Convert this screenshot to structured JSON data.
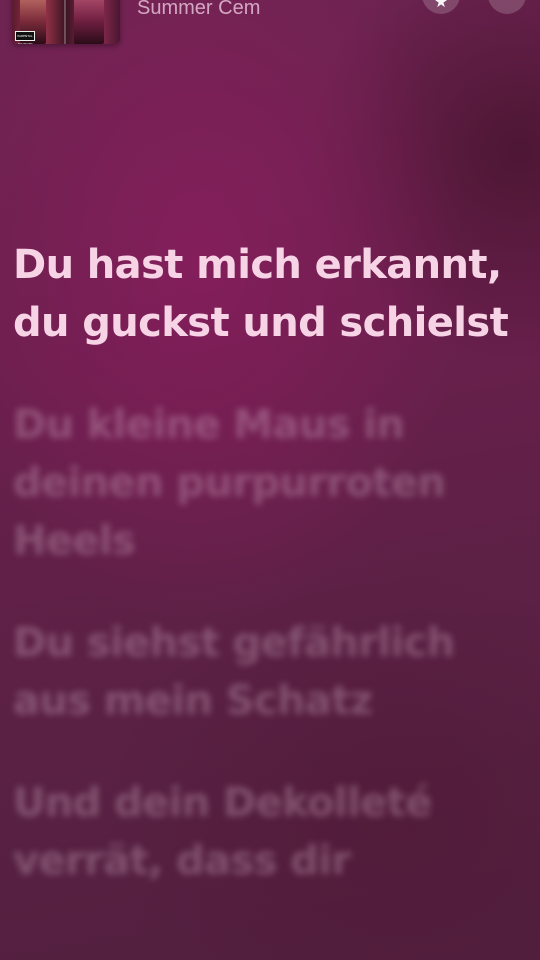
{
  "now_playing": {
    "artist": "Summer Cem",
    "artwork_badge": "PARENTAL ADVISORY"
  },
  "header_buttons": {
    "favorite_icon": "star-icon",
    "more_icon": "more-icon"
  },
  "lyrics": [
    {
      "text": "Du hast mich erkannt, du guckst und schielst",
      "state": "active"
    },
    {
      "text": "Du kleine Maus in deinen purpurroten Heels",
      "state": "upcoming"
    },
    {
      "text": "Du siehst gefährlich aus mein Schatz",
      "state": "upcoming"
    },
    {
      "text": "Und dein Dekolleté verrät, dass dir",
      "state": "upcoming"
    }
  ],
  "colors": {
    "active_lyric": "#f7d3e6",
    "background": "#6a1f4d"
  }
}
